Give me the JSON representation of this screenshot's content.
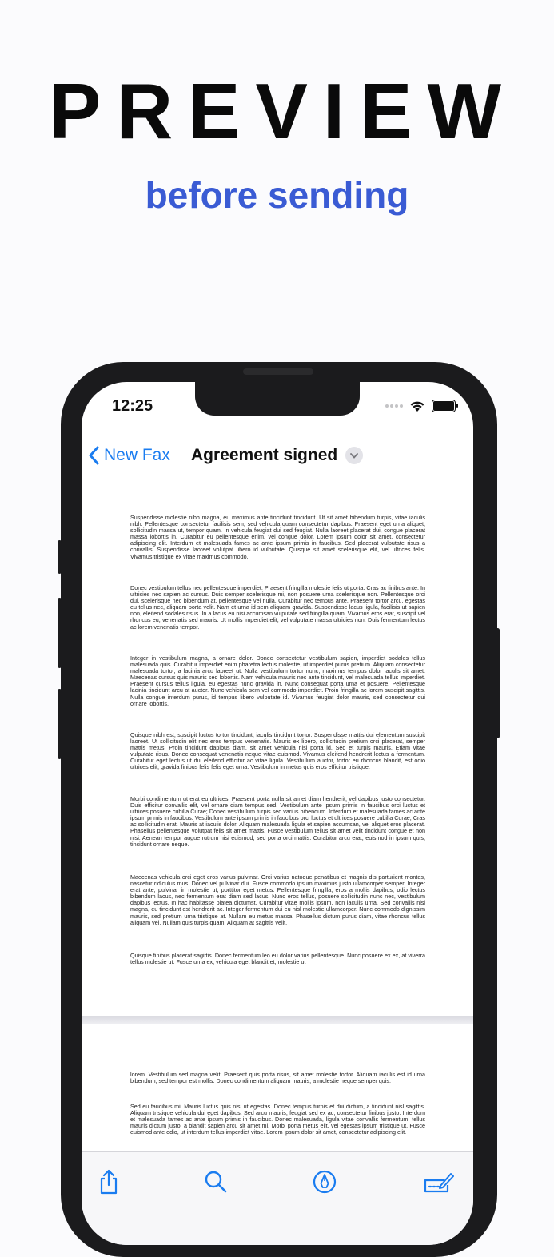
{
  "promo": {
    "headline": "PREVIEW",
    "subline": "before sending"
  },
  "status_bar": {
    "time": "12:25"
  },
  "nav": {
    "back_label": "New Fax",
    "title": "Agreement signed"
  },
  "document": {
    "page1": [
      "Suspendisse molestie nibh magna, eu maximus ante tincidunt tincidunt. Ut sit amet bibendum turpis, vitae iaculis nibh. Pellentesque consectetur facilisis sem, sed vehicula quam consectetur dapibus. Praesent eget urna aliquet, sollicitudin massa ut, tempor quam. In vehicula feugiat dui sed feugiat. Nulla laoreet placerat dui, congue placerat massa lobortis in. Curabitur eu pellentesque enim, vel congue dolor. Lorem ipsum dolor sit amet, consectetur adipiscing elit. Interdum et malesuada fames ac ante ipsum primis in faucibus. Sed placerat vulputate risus a convallis. Suspendisse laoreet volutpat libero id vulputate. Quisque sit amet scelerisque elit, vel ultrices felis. Vivamus tristique ex vitae maximus commodo.",
      "Donec vestibulum tellus nec pellentesque imperdiet. Praesent fringilla molestie felis ut porta. Cras ac finibus ante. In ultricies nec sapien ac cursus. Duis semper scelerisque mi, non posuere urna scelerisque non. Pellentesque orci dui, scelerisque nec bibendum at, pellentesque vel nulla. Curabitur nec tempus ante. Praesent tortor arcu, egestas eu tellus nec, aliquam porta velit. Nam et urna id sem aliquam gravida. Suspendisse lacus ligula, facilisis ut sapien non, eleifend sodales risus. In a lacus eu nisi accumsan vulputate sed fringilla quam. Vivamus eros erat, suscipit vel rhoncus eu, venenatis sed mauris. Ut mollis imperdiet elit, vel vulputate massa ultricies non. Duis fermentum lectus ac lorem venenatis tempor.",
      "Integer in vestibulum magna, a ornare dolor. Donec consectetur vestibulum sapien, imperdiet sodales tellus malesuada quis. Curabitur imperdiet enim pharetra lectus molestie, ut imperdiet purus pretium. Aliquam consectetur malesuada tortor, a lacinia arcu laoreet ut. Nulla vestibulum tortor nunc, maximus tempus dolor iaculis sit amet. Maecenas cursus quis mauris sed lobortis. Nam vehicula mauris nec ante tincidunt, vel malesuada tellus imperdiet. Praesent cursus tellus ligula, eu egestas nunc gravida in. Nunc consequat porta urna et posuere. Pellentesque lacinia tincidunt arcu at auctor. Nunc vehicula sem vel commodo imperdiet. Proin fringilla ac lorem suscipit sagittis. Nulla congue interdum purus, id tempus libero vulputate id. Vivamus feugiat dolor mauris, sed consectetur dui ornare lobortis.",
      "Quisque nibh est, suscipit luctus tortor tincidunt, iaculis tincidunt tortor. Suspendisse mattis dui elementum suscipit laoreet. Ut sollicitudin elit nec eros tempus venenatis. Mauris ex libero, sollicitudin pretium orci placerat, semper mattis metus. Proin tincidunt dapibus diam, sit amet vehicula nisi porta id. Sed et turpis mauris. Etiam vitae vulputate risus. Donec consequat venenatis neque vitae euismod. Vivamus eleifend hendrerit lectus a fermentum. Curabitur eget lectus ut dui eleifend efficitur ac vitae ligula. Vestibulum auctor, tortor eu rhoncus blandit, est odio ultrices elit, gravida finibus felis felis eget urna. Vestibulum in metus quis eros efficitur tristique.",
      "Morbi condimentum ut erat eu ultrices. Praesent porta nulla sit amet diam hendrerit, vel dapibus justo consectetur. Duis efficitur convallis elit, vel ornare diam tempus sed. Vestibulum ante ipsum primis in faucibus orci luctus et ultrices posuere cubilia Curae; Donec vestibulum turpis sed varius bibendum. Interdum et malesuada fames ac ante ipsum primis in faucibus. Vestibulum ante ipsum primis in faucibus orci luctus et ultrices posuere cubilia Curae; Cras ac sollicitudin erat. Mauris at iaculis dolor. Aliquam malesuada ligula et sapien accumsan, vel aliquet eros placerat. Phasellus pellentesque volutpat felis sit amet mattis. Fusce vestibulum tellus sit amet velit tincidunt congue et non nisi. Aenean tempor augue rutrum nisi euismod, sed porta orci mattis. Curabitur arcu erat, euismod in ipsum quis, tincidunt ornare neque.",
      "Maecenas vehicula orci eget eros varius pulvinar. Orci varius natoque penatibus et magnis dis parturient montes, nascetur ridiculus mus. Donec vel pulvinar dui. Fusce commodo ipsum maximus justo ullamcorper semper. Integer erat ante, pulvinar in molestie ut, porttitor eget metus. Pellentesque fringilla, eros a mollis dapibus, odio lectus bibendum lacus, nec fermentum erat diam sed lacus. Nunc eros tellus, posuere sollicitudin nunc nec, vestibulum dapibus lectus. In hac habitasse platea dictumst. Curabitur vitae mollis ipsum, non iaculis urna. Sed convallis nisi magna, eu tincidunt est hendrerit ac. Integer fermentum dui eu nisl molestie ullamcorper. Nunc commodo dignissim mauris, sed pretium urna tristique at. Nullam eu metus massa. Phasellus dictum purus diam, vitae rhoncus tellus aliquam vel. Nullam quis turpis quam. Aliquam at sagittis velit.",
      "Quisque finibus placerat sagittis. Donec fermentum leo eu dolor varius pellentesque. Nunc posuere ex ex, at viverra tellus molestie ut. Fusce urna ex, vehicula eget blandit et, molestie ut"
    ],
    "page2": [
      "lorem. Vestibulum sed magna velit. Praesent quis porta risus, sit amet molestie tortor. Aliquam iaculis est id urna bibendum, sed tempor est mollis. Donec condimentum aliquam mauris, a molestie neque semper quis.",
      "Sed eu faucibus mi. Mauris luctus quis nisi ut egestas. Donec tempus turpis et dui dictum, a tincidunt nisl sagittis. Aliquam tristique vehicula dui eget dapibus. Sed arcu mauris, feugiat sed ex ac, consectetur finibus justo. Interdum et malesuada fames ac ante ipsum primis in faucibus. Donec malesuada, ligula vitae convallis fermentum, tellus mauris dictum justo, a blandit sapien arcu sit amet mi. Morbi porta metus elit, vel egestas ipsum tristique ut. Fusce euismod ante odio, ut interdum tellus imperdiet vitae. Lorem ipsum dolor sit amet, consectetur adipiscing elit."
    ]
  },
  "toolbar": {
    "icons": [
      "share-icon",
      "search-icon",
      "markup-icon",
      "signature-icon"
    ]
  },
  "colors": {
    "accent": "#1a7cf0",
    "subline": "#3a5bd4",
    "headline": "#0a0a0a"
  }
}
